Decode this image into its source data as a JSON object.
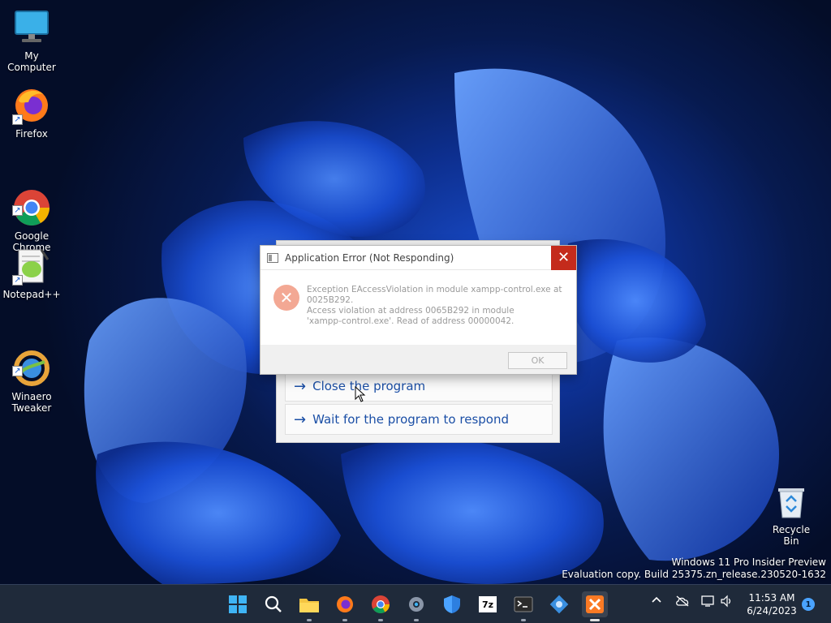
{
  "desktop": {
    "icons": [
      {
        "label": "My Computer"
      },
      {
        "label": "Firefox"
      },
      {
        "label": "Google\nChrome"
      },
      {
        "label": "Notepad++"
      },
      {
        "label": "Winaero\nTweaker"
      }
    ],
    "recycle_bin": {
      "label": "Recycle Bin"
    },
    "watermark": {
      "line1": "Windows 11 Pro Insider Preview",
      "line2": "Evaluation copy. Build 25375.zn_release.230520-1632"
    }
  },
  "not_responding_dialog": {
    "options": [
      {
        "label": "Close the program"
      },
      {
        "label": "Wait for the program to respond"
      }
    ]
  },
  "error_dialog": {
    "title": "Application Error (Not Responding)",
    "close_glyph": "✕",
    "message_line1": "Exception EAccessViolation in module xampp-control.exe at",
    "message_line2": "0025B292.",
    "message_line3": "Access violation at address 0065B292 in module",
    "message_line4": "'xampp-control.exe'. Read of address 00000042.",
    "ok_label": "OK"
  },
  "taskbar": {
    "apps": [
      "start-icon",
      "search-icon",
      "file-explorer-icon",
      "firefox-icon",
      "chrome-icon",
      "settings-icon",
      "security-icon",
      "7zip-icon",
      "terminal-icon",
      "winaero-icon",
      "xampp-icon"
    ],
    "sevenzip_label": "7z",
    "clock": {
      "time": "11:53 AM",
      "date": "6/24/2023"
    },
    "notification_count": "1"
  },
  "colors": {
    "accent": "#1b4fa6",
    "close_red": "#c42b1c",
    "taskbar_bg": "#1f2a3a"
  }
}
